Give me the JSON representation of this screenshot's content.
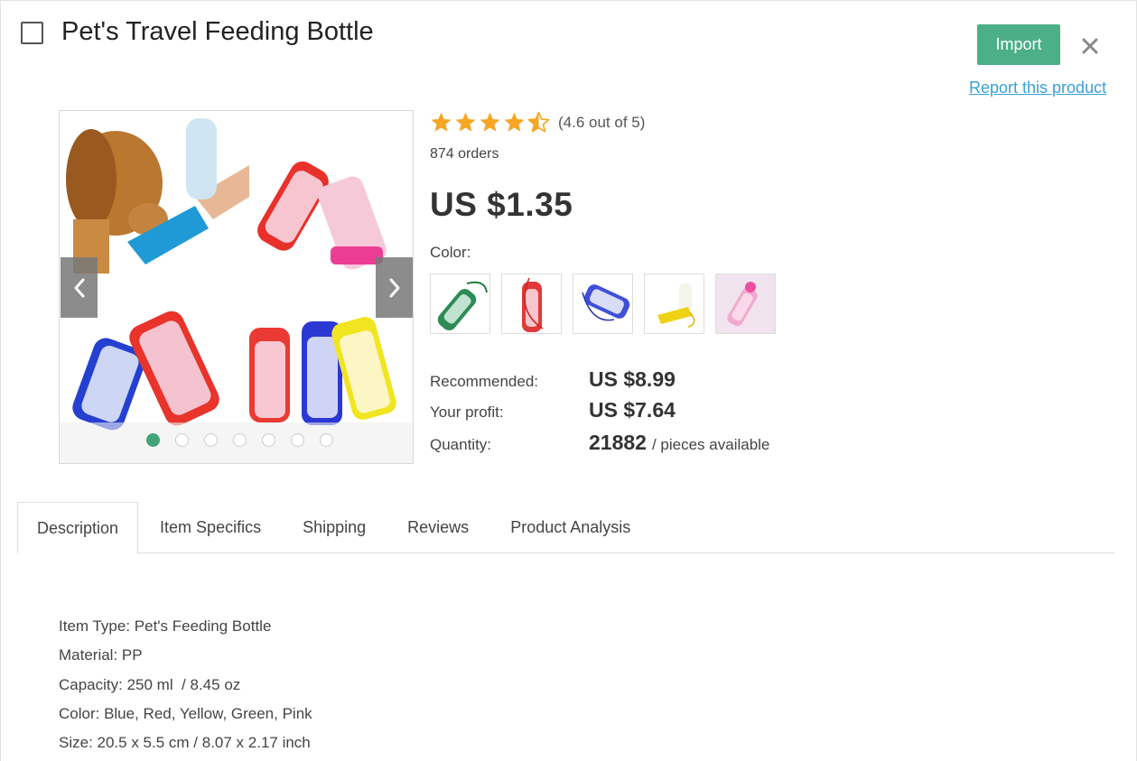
{
  "product": {
    "title": "Pet's Travel Feeding Bottle",
    "rating_text": "(4.6 out of 5)",
    "rating_value": 4.6,
    "rating_max": 5,
    "orders": "874 orders",
    "price": "US $1.35",
    "color_label": "Color:",
    "colors": [
      "green",
      "red",
      "blue",
      "yellow",
      "pink"
    ]
  },
  "actions": {
    "import_label": "Import",
    "report_label": "Report this product"
  },
  "gallery": {
    "slide_count": 7,
    "active_slide": 1
  },
  "pricing": {
    "recommended_label": "Recommended:",
    "recommended_value": "US $8.99",
    "profit_label": "Your profit:",
    "profit_value": "US $7.64",
    "quantity_label": "Quantity:",
    "quantity_value": "21882",
    "quantity_unit": "/ pieces available"
  },
  "tabs": [
    {
      "label": "Description",
      "active": true
    },
    {
      "label": "Item Specifics",
      "active": false
    },
    {
      "label": "Shipping",
      "active": false
    },
    {
      "label": "Reviews",
      "active": false
    },
    {
      "label": "Product Analysis",
      "active": false
    }
  ],
  "description": [
    "Item Type: Pet's Feeding Bottle",
    "Material: PP",
    "Capacity: 250 ml  / 8.45 oz",
    "Color: Blue, Red, Yellow, Green, Pink",
    "Size: 20.5 x 5.5 cm / 8.07 x 2.17 inch"
  ],
  "colors": {
    "accent": "#4caf88",
    "link": "#3aa0d8",
    "star": "#f5a623",
    "active_dot": "#43a47b"
  },
  "icons": {
    "close": "close-icon",
    "prev": "chevron-left-icon",
    "next": "chevron-right-icon",
    "star": "star-icon"
  }
}
